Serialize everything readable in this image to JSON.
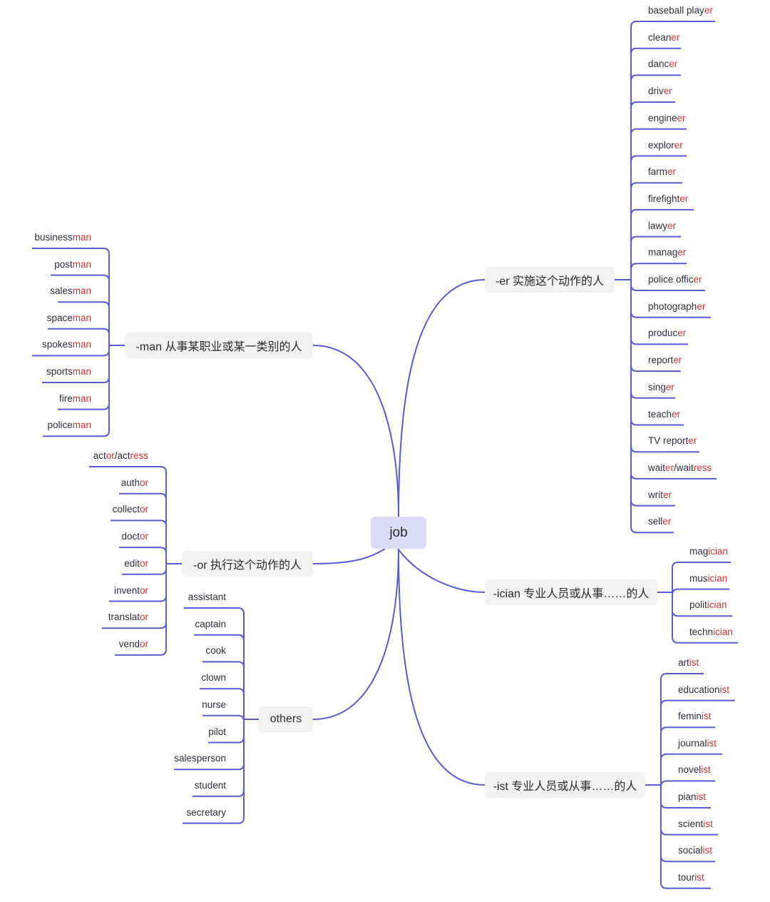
{
  "colors": {
    "line": "#5a5ad6",
    "suffix": "#d0343a",
    "root_bg": "#dcdcf6",
    "branch_bg": "#f2f2f2",
    "text": "#2e2e3a"
  },
  "root": {
    "label": "job"
  },
  "branches": [
    {
      "id": "er",
      "label": "-er 实施这个动作的人",
      "side": "right",
      "leaves": [
        [
          "baseball play",
          "er"
        ],
        [
          "clean",
          "er"
        ],
        [
          "danc",
          "er"
        ],
        [
          "driv",
          "er"
        ],
        [
          "engine",
          "er"
        ],
        [
          "explor",
          "er"
        ],
        [
          "farm",
          "er"
        ],
        [
          "firefight",
          "er"
        ],
        [
          "lawy",
          "er"
        ],
        [
          "manag",
          "er"
        ],
        [
          "police offic",
          "er"
        ],
        [
          "photograph",
          "er"
        ],
        [
          "produc",
          "er"
        ],
        [
          "report",
          "er"
        ],
        [
          "sing",
          "er"
        ],
        [
          "teach",
          "er"
        ],
        [
          "TV report",
          "er"
        ],
        [
          "wait",
          "er",
          "/wait",
          "ress"
        ],
        [
          "writ",
          "er"
        ],
        [
          "sell",
          "er"
        ]
      ]
    },
    {
      "id": "man",
      "label": "-man 从事某职业或某一类别的人",
      "side": "left",
      "leaves": [
        [
          "business",
          "man"
        ],
        [
          "post",
          "man"
        ],
        [
          "sales",
          "man"
        ],
        [
          "space",
          "man"
        ],
        [
          "spokes",
          "man"
        ],
        [
          "sports",
          "man"
        ],
        [
          "fire",
          "man"
        ],
        [
          "police",
          "man"
        ]
      ]
    },
    {
      "id": "or",
      "label": "-or 执行这个动作的人",
      "side": "left",
      "leaves": [
        [
          "act",
          "or",
          "/act",
          "ress"
        ],
        [
          "auth",
          "or"
        ],
        [
          "collect",
          "or"
        ],
        [
          "doct",
          "or"
        ],
        [
          "edit",
          "or"
        ],
        [
          "invent",
          "or"
        ],
        [
          "translat",
          "or"
        ],
        [
          "vend",
          "or"
        ]
      ]
    },
    {
      "id": "others",
      "label": "others",
      "side": "left",
      "leaves": [
        [
          "assistant"
        ],
        [
          "captain"
        ],
        [
          "cook"
        ],
        [
          "clown"
        ],
        [
          "nurse"
        ],
        [
          "pilot"
        ],
        [
          "salesperson"
        ],
        [
          "student"
        ],
        [
          "secretary"
        ]
      ]
    },
    {
      "id": "ician",
      "label": "-ician 专业人员或从事……的人",
      "side": "right",
      "leaves": [
        [
          "mag",
          "ician"
        ],
        [
          "mus",
          "ician"
        ],
        [
          "polit",
          "ician"
        ],
        [
          "techn",
          "ician"
        ]
      ]
    },
    {
      "id": "ist",
      "label": "-ist 专业人员或从事……的人",
      "side": "right",
      "leaves": [
        [
          "art",
          "ist"
        ],
        [
          "education",
          "ist"
        ],
        [
          "femin",
          "ist"
        ],
        [
          "journal",
          "ist"
        ],
        [
          "novel",
          "ist"
        ],
        [
          "pian",
          "ist"
        ],
        [
          "scient",
          "ist"
        ],
        [
          "social",
          "ist"
        ],
        [
          "tour",
          "ist"
        ]
      ]
    }
  ]
}
